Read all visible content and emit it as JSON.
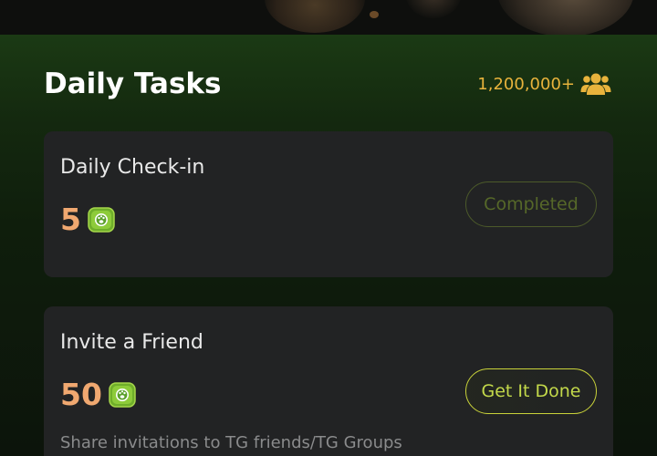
{
  "header": {
    "title": "Daily Tasks",
    "user_count": "1,200,000+",
    "user_count_icon": "users-group-icon"
  },
  "tasks": [
    {
      "title": "Daily Check-in",
      "reward": "5",
      "reward_icon": "green-token-icon",
      "action_label": "Completed",
      "status": "completed"
    },
    {
      "title": "Invite a Friend",
      "reward": "50",
      "reward_icon": "green-token-icon",
      "action_label": "Get It Done",
      "status": "pending",
      "description": "Share invitations to TG friends/TG Groups"
    }
  ],
  "colors": {
    "accent_gold": "#e8b33c",
    "reward_orange": "#f0a870",
    "action_green": "#c3d94a",
    "card_bg": "#222324"
  }
}
